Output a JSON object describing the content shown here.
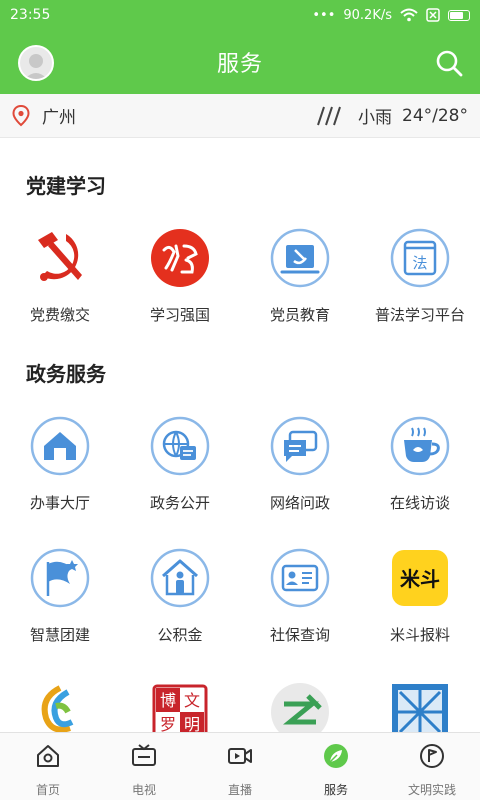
{
  "status": {
    "time": "23:55",
    "speed": "90.2K/s"
  },
  "header": {
    "title": "服务"
  },
  "weather": {
    "city": "广州",
    "condition": "小雨",
    "temp": "24°/28°"
  },
  "sections": [
    {
      "title": "党建学习",
      "items": [
        {
          "label": "党费缴交",
          "icon": "hammer-sickle-icon"
        },
        {
          "label": "学习强国",
          "icon": "xuexi-qiangguo-logo"
        },
        {
          "label": "党员教育",
          "icon": "party-flag-icon"
        },
        {
          "label": "普法学习平台",
          "icon": "law-book-icon"
        }
      ]
    },
    {
      "title": "政务服务",
      "items": [
        {
          "label": "办事大厅",
          "icon": "house-icon"
        },
        {
          "label": "政务公开",
          "icon": "globe-document-icon"
        },
        {
          "label": "网络问政",
          "icon": "chat-bubbles-icon"
        },
        {
          "label": "在线访谈",
          "icon": "teacup-icon"
        },
        {
          "label": "智慧团建",
          "icon": "flag-icon"
        },
        {
          "label": "公积金",
          "icon": "house-person-icon"
        },
        {
          "label": "社保查询",
          "icon": "id-card-icon"
        },
        {
          "label": "米斗报料",
          "icon": "midou-logo",
          "logo_text": "米斗"
        }
      ]
    }
  ],
  "partial_row": {
    "items": [
      {
        "icon": "swirl-logo"
      },
      {
        "icon": "bowen-seal-logo",
        "logo_text": [
          "博",
          "文",
          "罗",
          "明"
        ]
      },
      {
        "icon": "zhi-logo"
      },
      {
        "icon": "blue-window-logo"
      }
    ]
  },
  "nav": [
    {
      "label": "首页",
      "icon": "home-icon"
    },
    {
      "label": "电视",
      "icon": "tv-icon"
    },
    {
      "label": "直播",
      "icon": "video-icon"
    },
    {
      "label": "服务",
      "icon": "compass-leaf-icon",
      "active": true
    },
    {
      "label": "文明实践",
      "icon": "flag-circle-icon"
    }
  ],
  "colors": {
    "brand": "#5fc94b",
    "icon_blue": "#4a90d9",
    "icon_circle": "#8bb8e8",
    "party_red": "#d92b1f"
  }
}
